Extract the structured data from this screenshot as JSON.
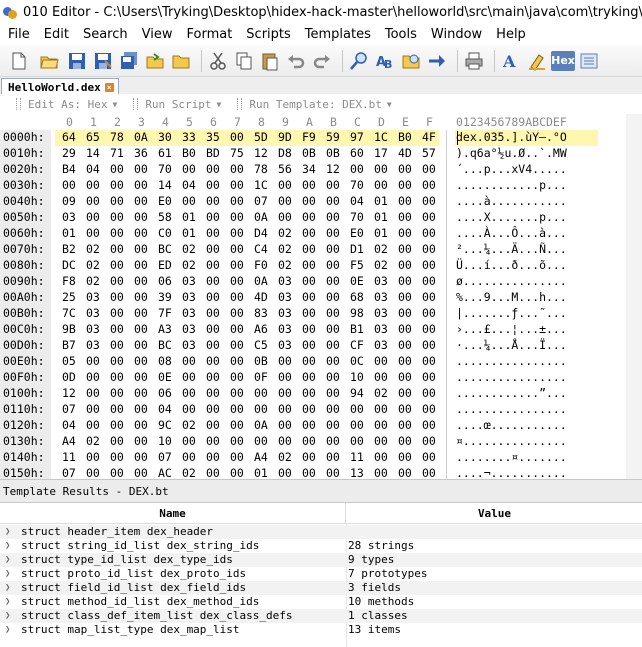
{
  "window": {
    "title": "010 Editor - C:\\Users\\Tryking\\Desktop\\hidex-hack-master\\helloworld\\src\\main\\java\\com\\tryking\\HelloWorld.dex"
  },
  "menu": [
    "File",
    "Edit",
    "Search",
    "View",
    "Format",
    "Scripts",
    "Templates",
    "Tools",
    "Window",
    "Help"
  ],
  "toolbar": {
    "icons": [
      "new-file-icon",
      "open-file-icon",
      "save-icon",
      "save-as-icon",
      "save-all-icon",
      "open-folder-icon",
      "folder-icon",
      "cut-icon",
      "copy-icon",
      "paste-icon",
      "undo-icon",
      "redo-icon",
      "find-icon",
      "replace-icon",
      "find-in-files-icon",
      "goto-icon",
      "print-icon",
      "font-icon",
      "highlight-icon",
      "hex-mode-icon",
      "hex-edit-icon"
    ],
    "hex_label": "Hex"
  },
  "tab": {
    "name": "HelloWorld.dex"
  },
  "subtoolbar": {
    "edit_as": "Edit As: Hex",
    "run_script": "Run Script",
    "run_template": "Run Template: DEX.bt"
  },
  "hex": {
    "columns": [
      "0",
      "1",
      "2",
      "3",
      "4",
      "5",
      "6",
      "7",
      "8",
      "9",
      "A",
      "B",
      "C",
      "D",
      "E",
      "F"
    ],
    "ascii_header": "0123456789ABCDEF",
    "rows": [
      {
        "addr": "0000h:",
        "bytes": [
          "64",
          "65",
          "78",
          "0A",
          "30",
          "33",
          "35",
          "00",
          "5D",
          "9D",
          "F9",
          "59",
          "97",
          "1C",
          "B0",
          "4F"
        ],
        "ascii": "dex.035.].ùY—.°O",
        "highlight": true
      },
      {
        "addr": "0010h:",
        "bytes": [
          "29",
          "14",
          "71",
          "36",
          "61",
          "B0",
          "BD",
          "75",
          "12",
          "D8",
          "0B",
          "0B",
          "60",
          "17",
          "4D",
          "57"
        ],
        "ascii": ").q6a°½u.Ø..`.MW",
        "highlight": false
      },
      {
        "addr": "0020h:",
        "bytes": [
          "B4",
          "04",
          "00",
          "00",
          "70",
          "00",
          "00",
          "00",
          "78",
          "56",
          "34",
          "12",
          "00",
          "00",
          "00",
          "00"
        ],
        "ascii": "´...p...xV4.....",
        "highlight": false
      },
      {
        "addr": "0030h:",
        "bytes": [
          "00",
          "00",
          "00",
          "00",
          "14",
          "04",
          "00",
          "00",
          "1C",
          "00",
          "00",
          "00",
          "70",
          "00",
          "00",
          "00"
        ],
        "ascii": "............p...",
        "highlight": false
      },
      {
        "addr": "0040h:",
        "bytes": [
          "09",
          "00",
          "00",
          "00",
          "E0",
          "00",
          "00",
          "00",
          "07",
          "00",
          "00",
          "00",
          "04",
          "01",
          "00",
          "00"
        ],
        "ascii": "....à...........",
        "highlight": false
      },
      {
        "addr": "0050h:",
        "bytes": [
          "03",
          "00",
          "00",
          "00",
          "58",
          "01",
          "00",
          "00",
          "0A",
          "00",
          "00",
          "00",
          "70",
          "01",
          "00",
          "00"
        ],
        "ascii": "....X.......p...",
        "highlight": false
      },
      {
        "addr": "0060h:",
        "bytes": [
          "01",
          "00",
          "00",
          "00",
          "C0",
          "01",
          "00",
          "00",
          "D4",
          "02",
          "00",
          "00",
          "E0",
          "01",
          "00",
          "00"
        ],
        "ascii": "....À...Ô...à...",
        "highlight": false
      },
      {
        "addr": "0070h:",
        "bytes": [
          "B2",
          "02",
          "00",
          "00",
          "BC",
          "02",
          "00",
          "00",
          "C4",
          "02",
          "00",
          "00",
          "D1",
          "02",
          "00",
          "00"
        ],
        "ascii": "²...¼...Ä...Ñ...",
        "highlight": false
      },
      {
        "addr": "0080h:",
        "bytes": [
          "DC",
          "02",
          "00",
          "00",
          "ED",
          "02",
          "00",
          "00",
          "F0",
          "02",
          "00",
          "00",
          "F5",
          "02",
          "00",
          "00"
        ],
        "ascii": "Ü...í...ð...õ...",
        "highlight": false
      },
      {
        "addr": "0090h:",
        "bytes": [
          "F8",
          "02",
          "00",
          "00",
          "06",
          "03",
          "00",
          "00",
          "0A",
          "03",
          "00",
          "00",
          "0E",
          "03",
          "00",
          "00"
        ],
        "ascii": "ø...............",
        "highlight": false
      },
      {
        "addr": "00A0h:",
        "bytes": [
          "25",
          "03",
          "00",
          "00",
          "39",
          "03",
          "00",
          "00",
          "4D",
          "03",
          "00",
          "00",
          "68",
          "03",
          "00",
          "00"
        ],
        "ascii": "%...9...M...h...",
        "highlight": false
      },
      {
        "addr": "00B0h:",
        "bytes": [
          "7C",
          "03",
          "00",
          "00",
          "7F",
          "03",
          "00",
          "00",
          "83",
          "03",
          "00",
          "00",
          "98",
          "03",
          "00",
          "00"
        ],
        "ascii": "|.......ƒ...˜...",
        "highlight": false
      },
      {
        "addr": "00C0h:",
        "bytes": [
          "9B",
          "03",
          "00",
          "00",
          "A3",
          "03",
          "00",
          "00",
          "A6",
          "03",
          "00",
          "00",
          "B1",
          "03",
          "00",
          "00"
        ],
        "ascii": "›...£...¦...±...",
        "highlight": false
      },
      {
        "addr": "00D0h:",
        "bytes": [
          "B7",
          "03",
          "00",
          "00",
          "BC",
          "03",
          "00",
          "00",
          "C5",
          "03",
          "00",
          "00",
          "CF",
          "03",
          "00",
          "00"
        ],
        "ascii": "·...¼...Å...Ï...",
        "highlight": false
      },
      {
        "addr": "00E0h:",
        "bytes": [
          "05",
          "00",
          "00",
          "00",
          "08",
          "00",
          "00",
          "00",
          "0B",
          "00",
          "00",
          "00",
          "0C",
          "00",
          "00",
          "00"
        ],
        "ascii": "................",
        "highlight": false
      },
      {
        "addr": "00F0h:",
        "bytes": [
          "0D",
          "00",
          "00",
          "00",
          "0E",
          "00",
          "00",
          "00",
          "0F",
          "00",
          "00",
          "00",
          "10",
          "00",
          "00",
          "00"
        ],
        "ascii": "................",
        "highlight": false
      },
      {
        "addr": "0100h:",
        "bytes": [
          "12",
          "00",
          "00",
          "00",
          "06",
          "00",
          "00",
          "00",
          "00",
          "00",
          "00",
          "00",
          "94",
          "02",
          "00",
          "00"
        ],
        "ascii": "............”...",
        "highlight": false
      },
      {
        "addr": "0110h:",
        "bytes": [
          "07",
          "00",
          "00",
          "00",
          "04",
          "00",
          "00",
          "00",
          "00",
          "00",
          "00",
          "00",
          "00",
          "00",
          "00",
          "00"
        ],
        "ascii": "................",
        "highlight": false
      },
      {
        "addr": "0120h:",
        "bytes": [
          "04",
          "00",
          "00",
          "00",
          "9C",
          "02",
          "00",
          "00",
          "0A",
          "00",
          "00",
          "00",
          "00",
          "00",
          "00",
          "00"
        ],
        "ascii": "....œ...........",
        "highlight": false
      },
      {
        "addr": "0130h:",
        "bytes": [
          "A4",
          "02",
          "00",
          "00",
          "10",
          "00",
          "00",
          "00",
          "00",
          "00",
          "00",
          "00",
          "00",
          "00",
          "00",
          "00"
        ],
        "ascii": "¤...............",
        "highlight": false
      },
      {
        "addr": "0140h:",
        "bytes": [
          "11",
          "00",
          "00",
          "00",
          "07",
          "00",
          "00",
          "00",
          "A4",
          "02",
          "00",
          "00",
          "11",
          "00",
          "00",
          "00"
        ],
        "ascii": "........¤.......",
        "highlight": false
      },
      {
        "addr": "0150h:",
        "bytes": [
          "07",
          "00",
          "00",
          "00",
          "AC",
          "02",
          "00",
          "00",
          "01",
          "00",
          "00",
          "00",
          "13",
          "00",
          "00",
          "00"
        ],
        "ascii": "....¬...........",
        "highlight": false
      }
    ]
  },
  "template_results": {
    "title": "Template Results - DEX.bt",
    "name_header": "Name",
    "value_header": "Value",
    "rows": [
      {
        "name": "struct header_item dex_header",
        "value": ""
      },
      {
        "name": "struct string_id_list dex_string_ids",
        "value": "28 strings"
      },
      {
        "name": "struct type_id_list dex_type_ids",
        "value": "9 types"
      },
      {
        "name": "struct proto_id_list dex_proto_ids",
        "value": "7 prototypes"
      },
      {
        "name": "struct field_id_list dex_field_ids",
        "value": "3 fields"
      },
      {
        "name": "struct method_id_list dex_method_ids",
        "value": "10 methods"
      },
      {
        "name": "struct class_def_item_list dex_class_defs",
        "value": "1 classes"
      },
      {
        "name": "struct map_list_type dex_map_list",
        "value": "13 items"
      }
    ]
  }
}
